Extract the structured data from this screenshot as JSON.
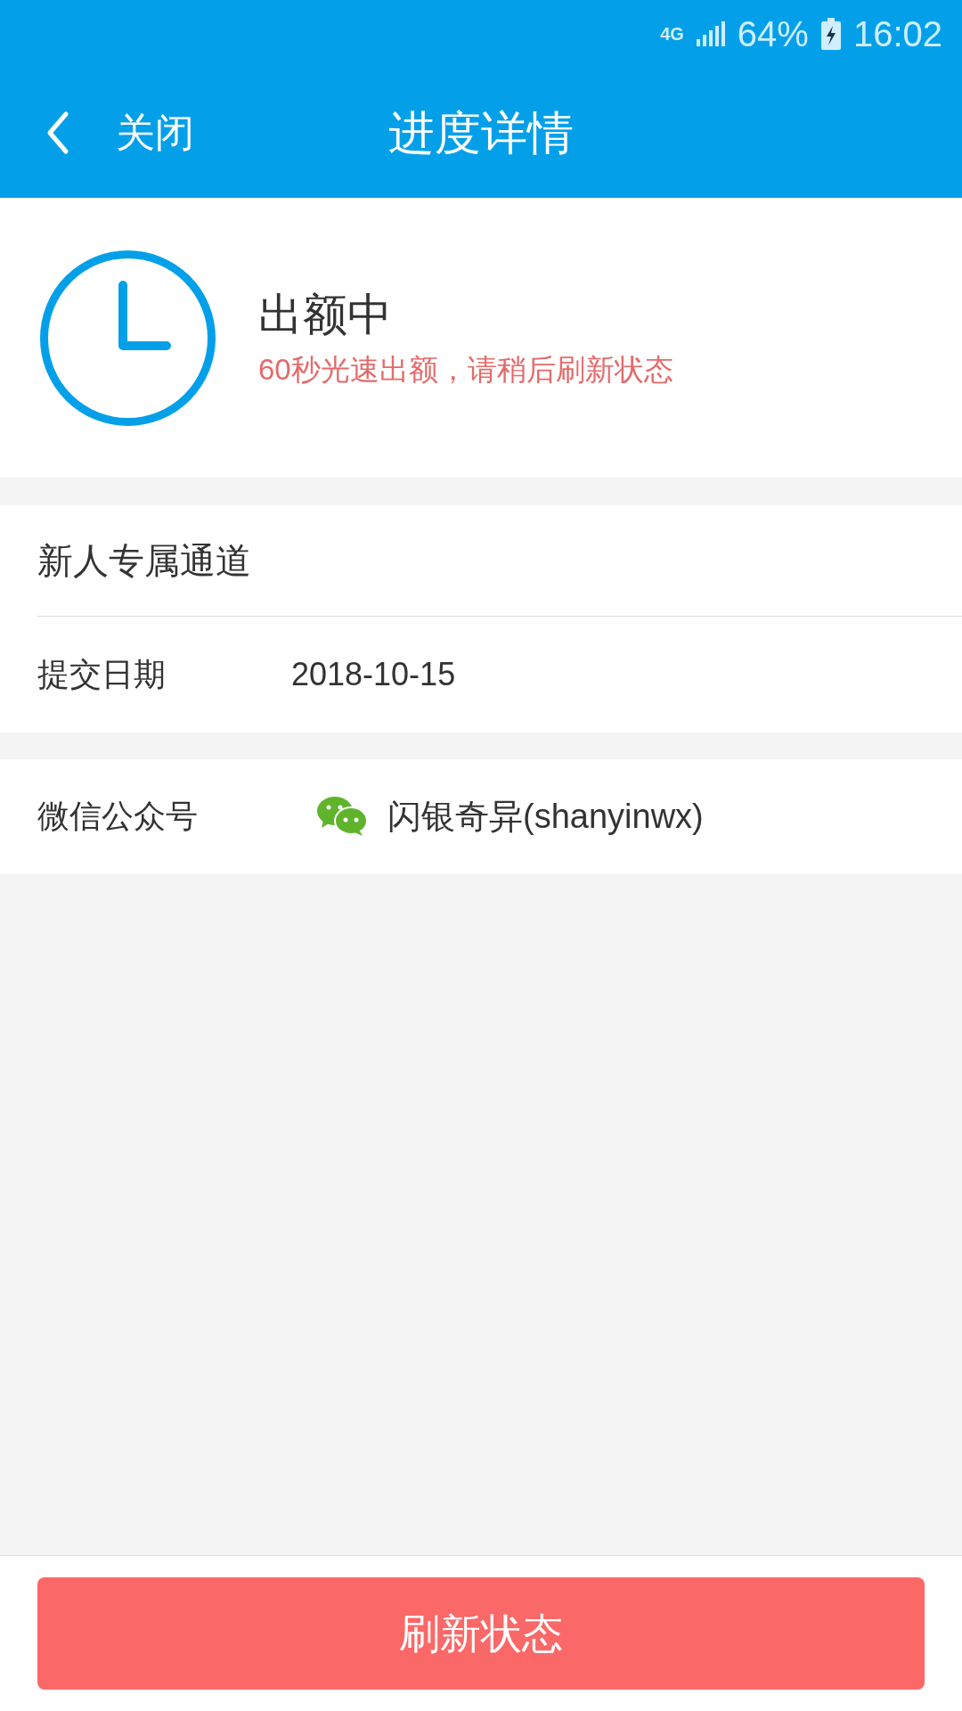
{
  "status_bar": {
    "network": "4G",
    "battery": "64%",
    "time": "16:02"
  },
  "nav": {
    "back_label": "关闭",
    "title": "进度详情"
  },
  "status": {
    "title": "出额中",
    "message": "60秒光速出额，请稍后刷新状态"
  },
  "details": [
    {
      "label": "新人专属通道"
    },
    {
      "label": "提交日期",
      "value": "2018-10-15"
    }
  ],
  "wechat": {
    "label": "微信公众号",
    "value": "闪银奇异(shanyinwx)"
  },
  "footer": {
    "button": "刷新状态"
  }
}
